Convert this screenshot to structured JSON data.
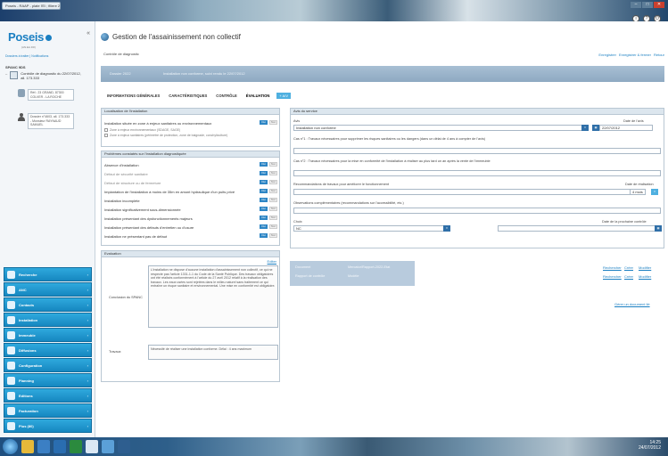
{
  "window": {
    "tab_title": "Poseis - RAAP - plate l'Ei ; filiere 2012",
    "controls": [
      "–",
      "□",
      "✕"
    ],
    "corner_icons": [
      "i",
      "?",
      "⏻"
    ]
  },
  "sidebar": {
    "logo": "Poseis",
    "logo_sub": "(AN.EA.FR)",
    "collapse": "«",
    "links": "Dossiers à traiter  |  Notifications",
    "heading": "SPANC 9DS",
    "tree_root": "Contrôle de diagnostic du 22/07/2012, all. 173.333",
    "node1": "Réf.: 23 GRAND, 87300 COLVER - LA ROCHE",
    "node2": "Dossier n°4603, all. 173.333 - Monsieur RAYNAUD SAMUEL",
    "menu": [
      {
        "label": "Recherche",
        "icon": "search-icon"
      },
      {
        "label": "ANC",
        "icon": "anc-icon"
      },
      {
        "label": "Contacts",
        "icon": "contacts-icon"
      },
      {
        "label": "Installation",
        "icon": "installation-icon"
      },
      {
        "label": "Immeuble",
        "icon": "building-icon"
      },
      {
        "label": "Diffusions",
        "icon": "diffusion-icon"
      },
      {
        "label": "Configuration",
        "icon": "configuration-icon"
      },
      {
        "label": "Planning",
        "icon": "planning-icon"
      },
      {
        "label": "Editions",
        "icon": "editions-icon"
      },
      {
        "label": "Facturation",
        "icon": "invoice-icon"
      },
      {
        "label": "Plus (80)",
        "icon": "more-icon"
      }
    ]
  },
  "main": {
    "title": "Gestion de l'assainissement non collectif",
    "sub_label": "Contrôle de diagnostic",
    "actions": [
      "Enregistrer",
      "Enregistrer & fermer",
      "Retour"
    ],
    "banner_id": "Dossier 2022",
    "banner_text": "Installation non conforme, suivi rendu le 22/07/2012",
    "tabs": [
      "INFORMATIONS GÉNÉRALES",
      "CARACTÉRISTIQUES",
      "CONTRÔLE",
      "ÉVALUATION"
    ],
    "tab_plus": "+ A/V",
    "localisation": {
      "header": "Localisation de l'installation",
      "question": "Installation située en zone à enjeux sanitaires ou environnementaux",
      "opt1": "Zone à enjeux environnementaux (SDAGE, SAGE)",
      "opt2": "Zone à enjeux sanitaires (périmètre de protection, zone de baignade, conchyliculture)",
      "yes": "Oui",
      "no": "Non"
    },
    "conformity": {
      "header": "Problèmes constatés sur l'installation diagnostiquée",
      "rows": [
        {
          "label": "Absence d'installation",
          "style": "normal"
        },
        {
          "label": "Défaut de sécurité sanitaire",
          "style": "muted"
        },
        {
          "label": "Défaut de structure ou de fermeture",
          "style": "muted"
        },
        {
          "label": "Implantation de l'installation à moins de 35m en amont hydraulique d'un puits privé",
          "style": "normal"
        },
        {
          "label": "Installation incomplète",
          "style": "normal"
        },
        {
          "label": "Installation significativement sous-dimensionnée",
          "style": "normal"
        },
        {
          "label": "Installation présentant des dysfonctionnements majeurs",
          "style": "normal"
        },
        {
          "label": "Installation présentant des défauts d'entretien ou d'usure",
          "style": "normal"
        },
        {
          "label": "Installation ne présentant pas de défaut",
          "style": "normal"
        }
      ]
    },
    "evaluation": {
      "header": "Evaluation",
      "link": "Editer",
      "conclusion_label": "Conclusion du SPANC",
      "conclusion_text": "L'installation ne dispose d'aucune installation d'assainissement non collectif, ce qui ne respecte pas l'article 1331-1-1 du Code de la Santé Publique. Des travaux obligatoires ont été réalisés conformément à l'article du 27 avril 2012 relatif à la réalisation des travaux. Les eaux usées sont rejetées dans le milieu naturel sans traitement ce qui entraîne un risque sanitaire et environnemental. Une mise en conformité est obligatoire.",
      "travaux_label": "Travaux",
      "travaux_text": "Nécessité de réaliser une installation conforme. Délai : 4 ans maximum"
    },
    "avis": {
      "header": "Avis du service",
      "avis_label": "Avis",
      "avis_value": "Installation non conforme",
      "date_label": "Date de l'avis",
      "date_value": "22/07/2012",
      "travaux_label": "Cas n°1 : Travaux nécessaires pour supprimer les risques sanitaires ou les dangers (dans un délai de 4 ans à compter de l'avis)",
      "travaux2_label": "Cas n°2 : Travaux nécessaires pour la mise en conformité de l'installation à réaliser au plus tard un an après la vente de l'immeuble",
      "reco_label": "Recommandations de travaux pour améliorer le fonctionnement",
      "reco_date_label": "Date de réalisation",
      "reco_date_value": "4 mois",
      "obs_label": "Observations complémentaires (recommandations sur l'accessibilité, etc.)",
      "choice_label": "Choix",
      "choice_value": "NC",
      "next_label": "Date de la prochaine contrôle",
      "doc1_label": "Document",
      "doc1_value": "Mercator/Rapport-2022-Etat",
      "doc2_label": "Rapport de contrôle",
      "doc2_value": "Modèle",
      "doc_links": [
        "Rechercher",
        "Créer",
        "Modifier"
      ],
      "report_link": "Gérer un document lié"
    }
  },
  "taskbar": {
    "time": "14:25",
    "date": "24/07/2012"
  }
}
